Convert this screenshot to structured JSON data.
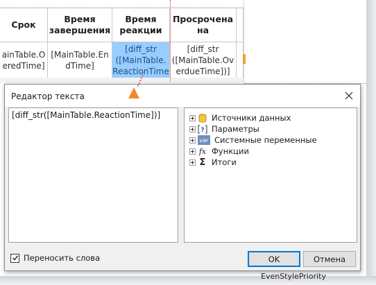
{
  "report": {
    "headers": [
      "Срок",
      "Время завершения",
      "Время реакции",
      "Просрочена на",
      ""
    ],
    "cells": [
      "ainTable.O eredTime]",
      "[MainTable.En dTime]",
      "[diff_str ([MainTable. ReactionTime",
      "[diff_str ([MainTable.Ov erdueTime])]",
      ""
    ],
    "peek_label": "EvenStylePriority"
  },
  "dialog": {
    "title": "Редактор текста",
    "expression": "[diff_str([MainTable.ReactionTime])]",
    "tree": [
      {
        "label": "Источники данных",
        "icon": "database-icon"
      },
      {
        "label": "Параметры",
        "icon": "parameter-icon"
      },
      {
        "label": "Системные переменные",
        "icon": "variable-icon",
        "icon_text": "var"
      },
      {
        "label": "Функции",
        "icon": "function-icon",
        "icon_text": "fx"
      },
      {
        "label": "Итоги",
        "icon": "sum-icon",
        "icon_text": "Σ"
      }
    ],
    "wrap_words_label": "Переносить слова",
    "wrap_words_checked": true,
    "ok_label": "OK",
    "cancel_label": "Отмена"
  },
  "colors": {
    "selected_cell": "#99ccff",
    "accent": "#0078d7",
    "arrow": "#f08a2a"
  }
}
